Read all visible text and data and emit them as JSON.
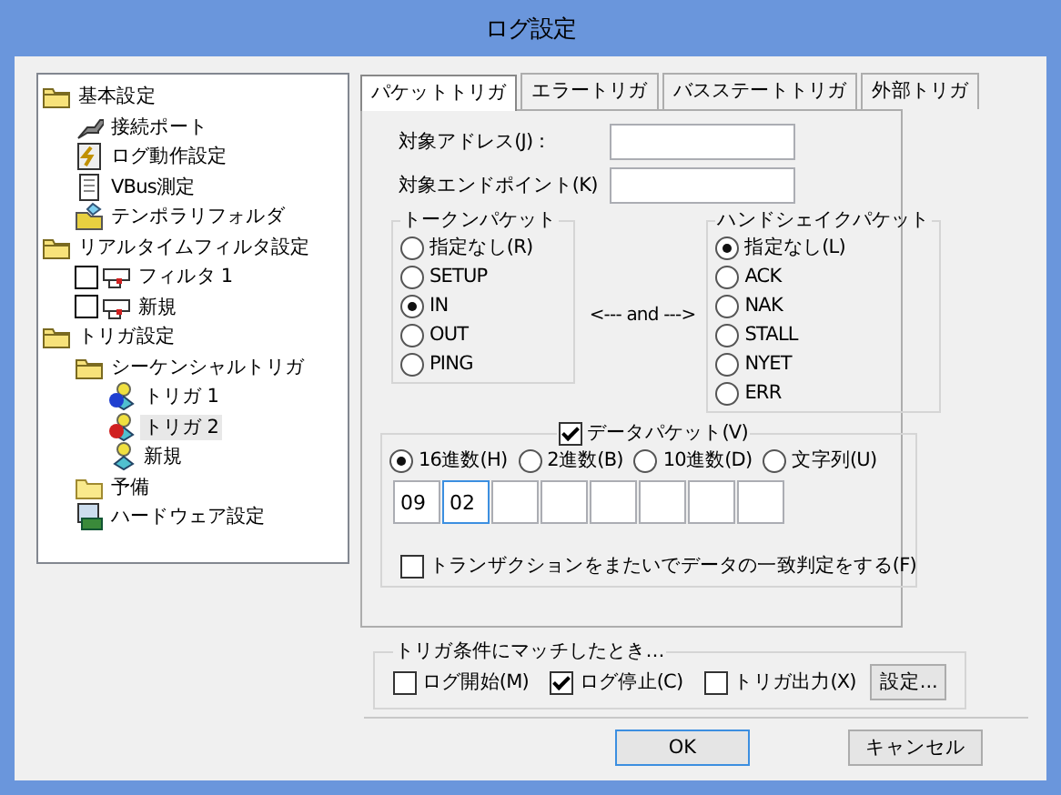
{
  "window": {
    "title": "ログ設定"
  },
  "tree": [
    {
      "label": "基本設定",
      "kind": "folder",
      "selected": false,
      "children": [
        {
          "label": "接続ポート",
          "kind": "port",
          "selected": false
        },
        {
          "label": "ログ動作設定",
          "kind": "log",
          "selected": false
        },
        {
          "label": "VBus測定",
          "kind": "vbus",
          "selected": false
        },
        {
          "label": "テンポラリフォルダ",
          "kind": "temp",
          "selected": false
        }
      ]
    },
    {
      "label": "リアルタイムフィルタ設定",
      "kind": "folder",
      "selected": false,
      "children": [
        {
          "label": "フィルタ 1",
          "kind": "filter",
          "checked": false,
          "selected": false
        },
        {
          "label": "新規",
          "kind": "filter",
          "checked": false,
          "selected": false
        }
      ]
    },
    {
      "label": "トリガ設定",
      "kind": "folder",
      "selected": false,
      "children": [
        {
          "label": "シーケンシャルトリガ",
          "kind": "folder",
          "selected": false,
          "children": [
            {
              "label": "トリガ 1",
              "kind": "trigger",
              "color": "#1f3fd0",
              "selected": false
            },
            {
              "label": "トリガ 2",
              "kind": "trigger",
              "color": "#d02020",
              "selected": true
            },
            {
              "label": "新規",
              "kind": "trigger",
              "selected": false
            }
          ]
        },
        {
          "label": "予備",
          "kind": "plain-folder",
          "selected": false
        },
        {
          "label": "ハードウェア設定",
          "kind": "hardware",
          "selected": false
        }
      ]
    }
  ],
  "tabs": [
    {
      "label": "パケットトリガ",
      "selected": true
    },
    {
      "label": "エラートリガ",
      "selected": false
    },
    {
      "label": "バスステートトリガ",
      "selected": false
    },
    {
      "label": "外部トリガ",
      "selected": false
    }
  ],
  "fields": [
    {
      "label": "対象アドレス(J)："
    },
    {
      "label": "対象エンドポイント(K)"
    }
  ],
  "token_packet": {
    "title": "トークンパケット",
    "options": [
      {
        "label": "指定なし(R)",
        "selected": false
      },
      {
        "label": "SETUP",
        "selected": false
      },
      {
        "label": "IN",
        "selected": true
      },
      {
        "label": "OUT",
        "selected": false
      },
      {
        "label": "PING",
        "selected": false
      }
    ]
  },
  "and_label": "<--- and --->",
  "handshake_packet": {
    "title": "ハンドシェイクパケット",
    "options": [
      {
        "label": "指定なし(L)",
        "selected": true
      },
      {
        "label": "ACK",
        "selected": false
      },
      {
        "label": "NAK",
        "selected": false
      },
      {
        "label": "STALL",
        "selected": false
      },
      {
        "label": "NYET",
        "selected": false
      },
      {
        "label": "ERR",
        "selected": false
      }
    ]
  },
  "data_packet": {
    "label": "データパケット(V)",
    "checked": true,
    "formats": [
      {
        "label": "16進数(H)",
        "selected": true
      },
      {
        "label": "2進数(B)",
        "selected": false
      },
      {
        "label": "10進数(D)",
        "selected": false
      },
      {
        "label": "文字列(U)",
        "selected": false
      }
    ],
    "bytes": [
      {
        "value": "09",
        "focused": false
      },
      {
        "value": "02",
        "focused": true
      },
      {
        "focused": false
      },
      {
        "focused": false
      },
      {
        "focused": false
      },
      {
        "focused": false
      },
      {
        "focused": false
      },
      {
        "focused": false
      }
    ],
    "cross_transaction": {
      "label": "トランザクションをまたいでデータの一致判定をする(F)",
      "checked": false
    }
  },
  "trigger_action": {
    "title": "トリガ条件にマッチしたとき…",
    "options": [
      {
        "label": "ログ開始(M)",
        "checked": false
      },
      {
        "label": "ログ停止(C)",
        "checked": true
      },
      {
        "label": "トリガ出力(X)",
        "checked": false
      }
    ],
    "settings_button": "設定..."
  },
  "buttons": [
    {
      "label": "OK",
      "default": true
    },
    {
      "label": "キャンセル",
      "default": false
    }
  ]
}
